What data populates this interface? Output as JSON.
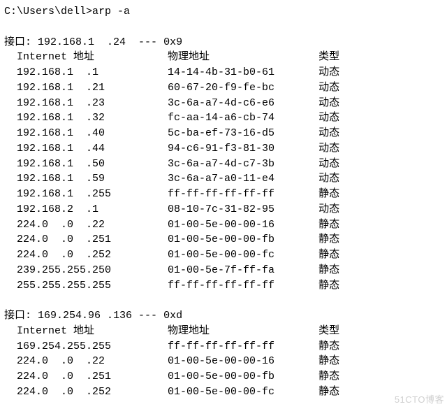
{
  "prompt": "C:\\Users\\dell>",
  "command": "arp -a",
  "interfaces": [
    {
      "header_prefix": "接口: ",
      "ip": "192.168.1.24",
      "separator": " --- ",
      "hexid": "0x9",
      "col_header": {
        "ip": "Internet 地址",
        "mac": "物理地址",
        "type": "类型"
      },
      "entries": [
        {
          "ip": "192.168.1.1",
          "mac": "14-14-4b-31-b0-61",
          "type": "动态"
        },
        {
          "ip": "192.168.1.21",
          "mac": "60-67-20-f9-fe-bc",
          "type": "动态"
        },
        {
          "ip": "192.168.1.23",
          "mac": "3c-6a-a7-4d-c6-e6",
          "type": "动态"
        },
        {
          "ip": "192.168.1.32",
          "mac": "fc-aa-14-a6-cb-74",
          "type": "动态"
        },
        {
          "ip": "192.168.1.40",
          "mac": "5c-ba-ef-73-16-d5",
          "type": "动态"
        },
        {
          "ip": "192.168.1.44",
          "mac": "94-c6-91-f3-81-30",
          "type": "动态"
        },
        {
          "ip": "192.168.1.50",
          "mac": "3c-6a-a7-4d-c7-3b",
          "type": "动态"
        },
        {
          "ip": "192.168.1.59",
          "mac": "3c-6a-a7-a0-11-e4",
          "type": "动态"
        },
        {
          "ip": "192.168.1.255",
          "mac": "ff-ff-ff-ff-ff-ff",
          "type": "静态"
        },
        {
          "ip": "192.168.2.1",
          "mac": "08-10-7c-31-82-95",
          "type": "动态"
        },
        {
          "ip": "224.0.0.22",
          "mac": "01-00-5e-00-00-16",
          "type": "静态"
        },
        {
          "ip": "224.0.0.251",
          "mac": "01-00-5e-00-00-fb",
          "type": "静态"
        },
        {
          "ip": "224.0.0.252",
          "mac": "01-00-5e-00-00-fc",
          "type": "静态"
        },
        {
          "ip": "239.255.255.250",
          "mac": "01-00-5e-7f-ff-fa",
          "type": "静态"
        },
        {
          "ip": "255.255.255.255",
          "mac": "ff-ff-ff-ff-ff-ff",
          "type": "静态"
        }
      ]
    },
    {
      "header_prefix": "接口: ",
      "ip": "169.254.96.136",
      "separator": " --- ",
      "hexid": "0xd",
      "col_header": {
        "ip": "Internet 地址",
        "mac": "物理地址",
        "type": "类型"
      },
      "entries": [
        {
          "ip": "169.254.255.255",
          "mac": "ff-ff-ff-ff-ff-ff",
          "type": "静态"
        },
        {
          "ip": "224.0.0.22",
          "mac": "01-00-5e-00-00-16",
          "type": "静态"
        },
        {
          "ip": "224.0.0.251",
          "mac": "01-00-5e-00-00-fb",
          "type": "静态"
        },
        {
          "ip": "224.0.0.252",
          "mac": "01-00-5e-00-00-fc",
          "type": "静态"
        }
      ]
    }
  ],
  "watermark": "51CTO博客"
}
